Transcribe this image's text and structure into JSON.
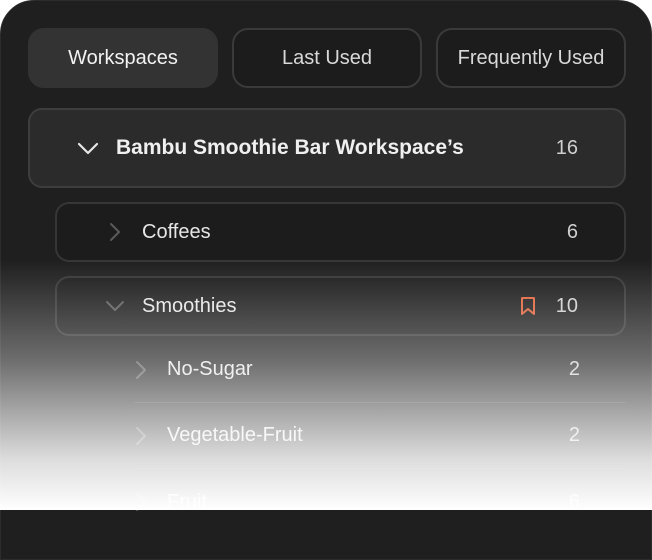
{
  "tabs": [
    {
      "label": "Workspaces",
      "active": true
    },
    {
      "label": "Last Used",
      "active": false
    },
    {
      "label": "Frequently Used",
      "active": false
    }
  ],
  "workspace": {
    "name": "Bambu Smoothie Bar Workspace’s",
    "count": "16",
    "expanded": true
  },
  "folders": [
    {
      "name": "Coffees",
      "count": "6",
      "expanded": false,
      "bookmarked": false
    },
    {
      "name": "Smoothies",
      "count": "10",
      "expanded": true,
      "bookmarked": true
    }
  ],
  "subfolders": [
    {
      "name": "No-Sugar",
      "count": "2"
    },
    {
      "name": "Vegetable-Fruit",
      "count": "2"
    },
    {
      "name": "Fruit",
      "count": "6"
    }
  ],
  "colors": {
    "panel_bg": "#1f1f1f",
    "active_tab_bg": "#333333",
    "bookmark_accent": "#e0623a"
  },
  "icons": {
    "collapse": "chevron-down-icon",
    "expand": "chevron-right-icon",
    "bookmark": "bookmark-icon"
  }
}
